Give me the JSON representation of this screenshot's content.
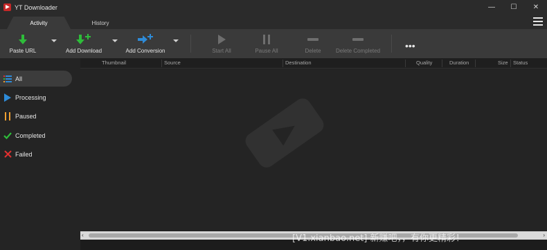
{
  "window": {
    "title": "YT Downloader",
    "minimize_glyph": "—",
    "maximize_glyph": "☐",
    "close_glyph": "✕"
  },
  "tabs": [
    {
      "label": "Activity",
      "active": true
    },
    {
      "label": "History",
      "active": false
    }
  ],
  "toolbar": {
    "paste_url": "Paste URL",
    "add_download": "Add Download",
    "add_conversion": "Add Conversion",
    "start_all": "Start All",
    "pause_all": "Pause All",
    "delete": "Delete",
    "delete_completed": "Delete Completed",
    "more": "•••"
  },
  "sidebar": {
    "items": [
      {
        "label": "All",
        "icon": "list-icon",
        "active": true
      },
      {
        "label": "Processing",
        "icon": "play-icon",
        "color": "#2e8bd8"
      },
      {
        "label": "Paused",
        "icon": "pause-icon",
        "color": "#f0a030"
      },
      {
        "label": "Completed",
        "icon": "check-icon",
        "color": "#2ebd3a"
      },
      {
        "label": "Failed",
        "icon": "x-icon",
        "color": "#e03030"
      }
    ]
  },
  "table": {
    "columns": [
      "Thumbnail",
      "Source",
      "Destination",
      "Quality",
      "Duration",
      "Size",
      "Status"
    ]
  },
  "footer": {
    "watermark": "[V1.xianbao.net] 新赚吧，，有你更精彩！"
  },
  "colors": {
    "accent_green": "#2ebd3a",
    "accent_blue": "#2e8bd8",
    "toolbar_bg": "#3a3a3a",
    "content_bg": "#242424"
  }
}
